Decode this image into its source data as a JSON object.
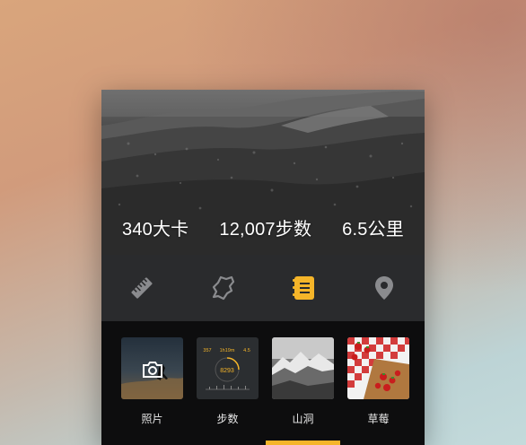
{
  "stats": {
    "calories": "340大卡",
    "steps": "12,007步数",
    "distance": "6.5公里"
  },
  "toolbar": {
    "icons": [
      "ruler-icon",
      "map-route-icon",
      "notes-icon",
      "location-pin-icon"
    ],
    "active_index": 2,
    "active_color": "#f5b529",
    "inactive_color": "#8a8b8e"
  },
  "gallery": {
    "items": [
      {
        "label": "照片",
        "thumb": "camera-photo-thumbnail"
      },
      {
        "label": "步数",
        "thumb": "step-stats-thumbnail"
      },
      {
        "label": "山洞",
        "thumb": "mountain-thumbnail"
      },
      {
        "label": "草莓",
        "thumb": "strawberry-thumbnail"
      }
    ],
    "step_thumb": {
      "top": [
        "357",
        "1h19m",
        "4.5"
      ],
      "main": "8293"
    }
  }
}
